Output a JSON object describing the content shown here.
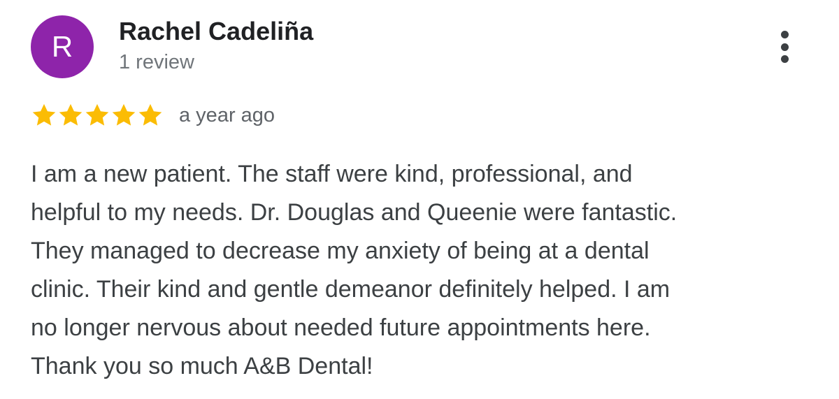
{
  "review": {
    "avatar_initial": "R",
    "reviewer_name": "Rachel Cadeliña",
    "review_count": "1 review",
    "rating": 5,
    "rating_max": 5,
    "time_ago": "a year ago",
    "text_lines": [
      "I am a new patient. The staff were kind, professional, and",
      "helpful to my needs. Dr. Douglas and Queenie were fantastic.",
      "They managed to decrease my anxiety of being at a dental",
      "clinic. Their kind and gentle demeanor definitely helped. I am",
      "no longer nervous about needed future appointments here.",
      "Thank you so much A&B Dental!"
    ]
  },
  "icons": {
    "more": "more-vert-icon",
    "star": "star-icon"
  },
  "colors": {
    "avatar_bg": "#8e24aa",
    "star": "#fbbc04",
    "name": "#202124",
    "secondary_text": "#70757a",
    "body_text": "#3c4043"
  }
}
